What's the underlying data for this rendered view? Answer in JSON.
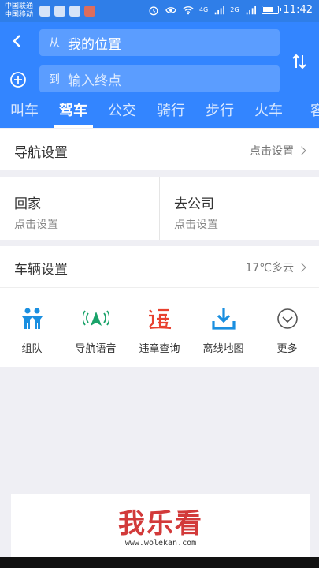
{
  "status_bar": {
    "carrier1": "中国联通",
    "carrier2": "中国移动",
    "net1": "4G",
    "net2": "2G",
    "time": "11:42",
    "battery_level": 0.7
  },
  "header": {
    "from_prefix": "从",
    "from_value": "我的位置",
    "to_prefix": "到",
    "to_placeholder": "输入终点",
    "tabs": [
      "叫车",
      "驾车",
      "公交",
      "骑行",
      "步行",
      "火车",
      "客"
    ],
    "active_tab": "驾车"
  },
  "nav_settings": {
    "label": "导航设置",
    "value": "点击设置"
  },
  "shortcuts": {
    "home": {
      "title": "回家",
      "sub": "点击设置"
    },
    "work": {
      "title": "去公司",
      "sub": "点击设置"
    }
  },
  "vehicle": {
    "label": "车辆设置",
    "weather": "17℃多云"
  },
  "tools": [
    {
      "label": "组队",
      "icon": "team-icon",
      "color": "#1a8fe0"
    },
    {
      "label": "导航语音",
      "icon": "voice-nav-icon",
      "color": "#1aa36a"
    },
    {
      "label": "违章查询",
      "icon": "violation-icon",
      "color": "#e8412f"
    },
    {
      "label": "离线地图",
      "icon": "offline-map-icon",
      "color": "#1a8fe0"
    },
    {
      "label": "更多",
      "icon": "more-icon",
      "color": "#555555"
    }
  ],
  "ad": {
    "brand": "我乐看",
    "url": "www.wolekan.com"
  },
  "colors": {
    "primary": "#3385ff",
    "background": "#efeff4"
  }
}
